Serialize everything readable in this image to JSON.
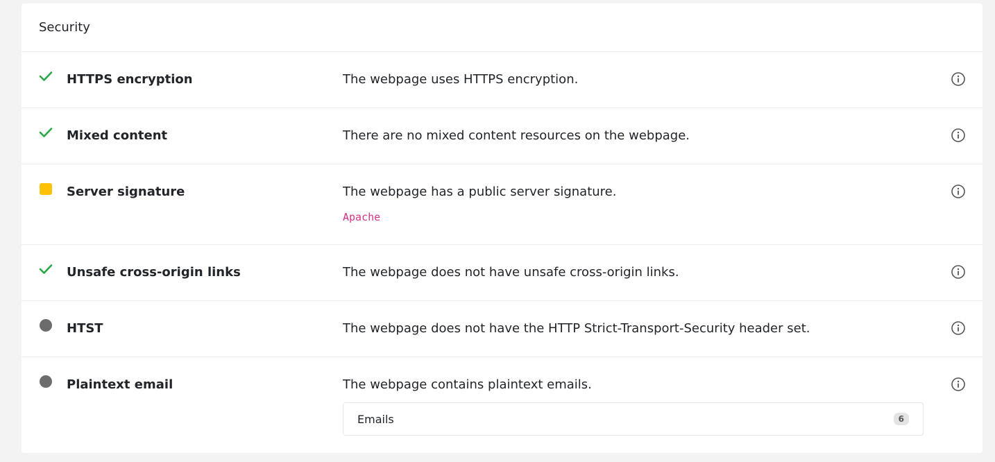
{
  "card": {
    "title": "Security"
  },
  "rows": [
    {
      "title": "HTTPS encryption",
      "description": "The webpage uses HTTPS encryption.",
      "status": "pass"
    },
    {
      "title": "Mixed content",
      "description": "There are no mixed content resources on the webpage.",
      "status": "pass"
    },
    {
      "title": "Server signature",
      "description": "The webpage has a public server signature.",
      "status": "warning",
      "detail": "Apache"
    },
    {
      "title": "Unsafe cross-origin links",
      "description": "The webpage does not have unsafe cross-origin links.",
      "status": "pass"
    },
    {
      "title": "HTST",
      "description": "The webpage does not have the HTTP Strict-Transport-Security header set.",
      "status": "neutral"
    },
    {
      "title": "Plaintext email",
      "description": "The webpage contains plaintext emails.",
      "status": "neutral",
      "expander": {
        "label": "Emails",
        "count": "6"
      }
    }
  ],
  "colors": {
    "pass": "#28a745",
    "warning": "#ffc107",
    "neutral": "#6c6c6c",
    "code": "#d63384"
  },
  "icons": {
    "pass": "check-icon",
    "warning": "warning-square-icon",
    "neutral": "neutral-dot-icon",
    "info": "info-icon"
  }
}
